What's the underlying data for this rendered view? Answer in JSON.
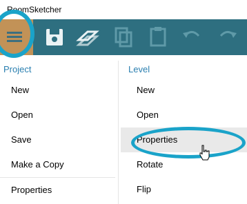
{
  "app": {
    "title": "RoomSketcher"
  },
  "toolbar": {
    "buttons": [
      {
        "name": "menu-button",
        "icon": "hamburger-icon"
      },
      {
        "name": "save-button",
        "icon": "floppy-disk-icon"
      },
      {
        "name": "layers-button",
        "icon": "layers-icon"
      },
      {
        "name": "copy-button",
        "icon": "copy-icon"
      },
      {
        "name": "paste-button",
        "icon": "clipboard-icon"
      },
      {
        "name": "undo-button",
        "icon": "undo-icon"
      },
      {
        "name": "redo-button",
        "icon": "redo-icon"
      }
    ]
  },
  "project": {
    "header": "Project",
    "items": [
      "New",
      "Open",
      "Save",
      "Make a Copy",
      "Properties"
    ]
  },
  "level": {
    "header": "Level",
    "items": [
      "New",
      "Open",
      "Properties",
      "Rotate",
      "Flip"
    ]
  },
  "colors": {
    "toolbar_bg": "#2e6f80",
    "menu_button_bg": "#c29257",
    "highlight": "#1aa3c9",
    "header_text": "#2a7fb0"
  }
}
